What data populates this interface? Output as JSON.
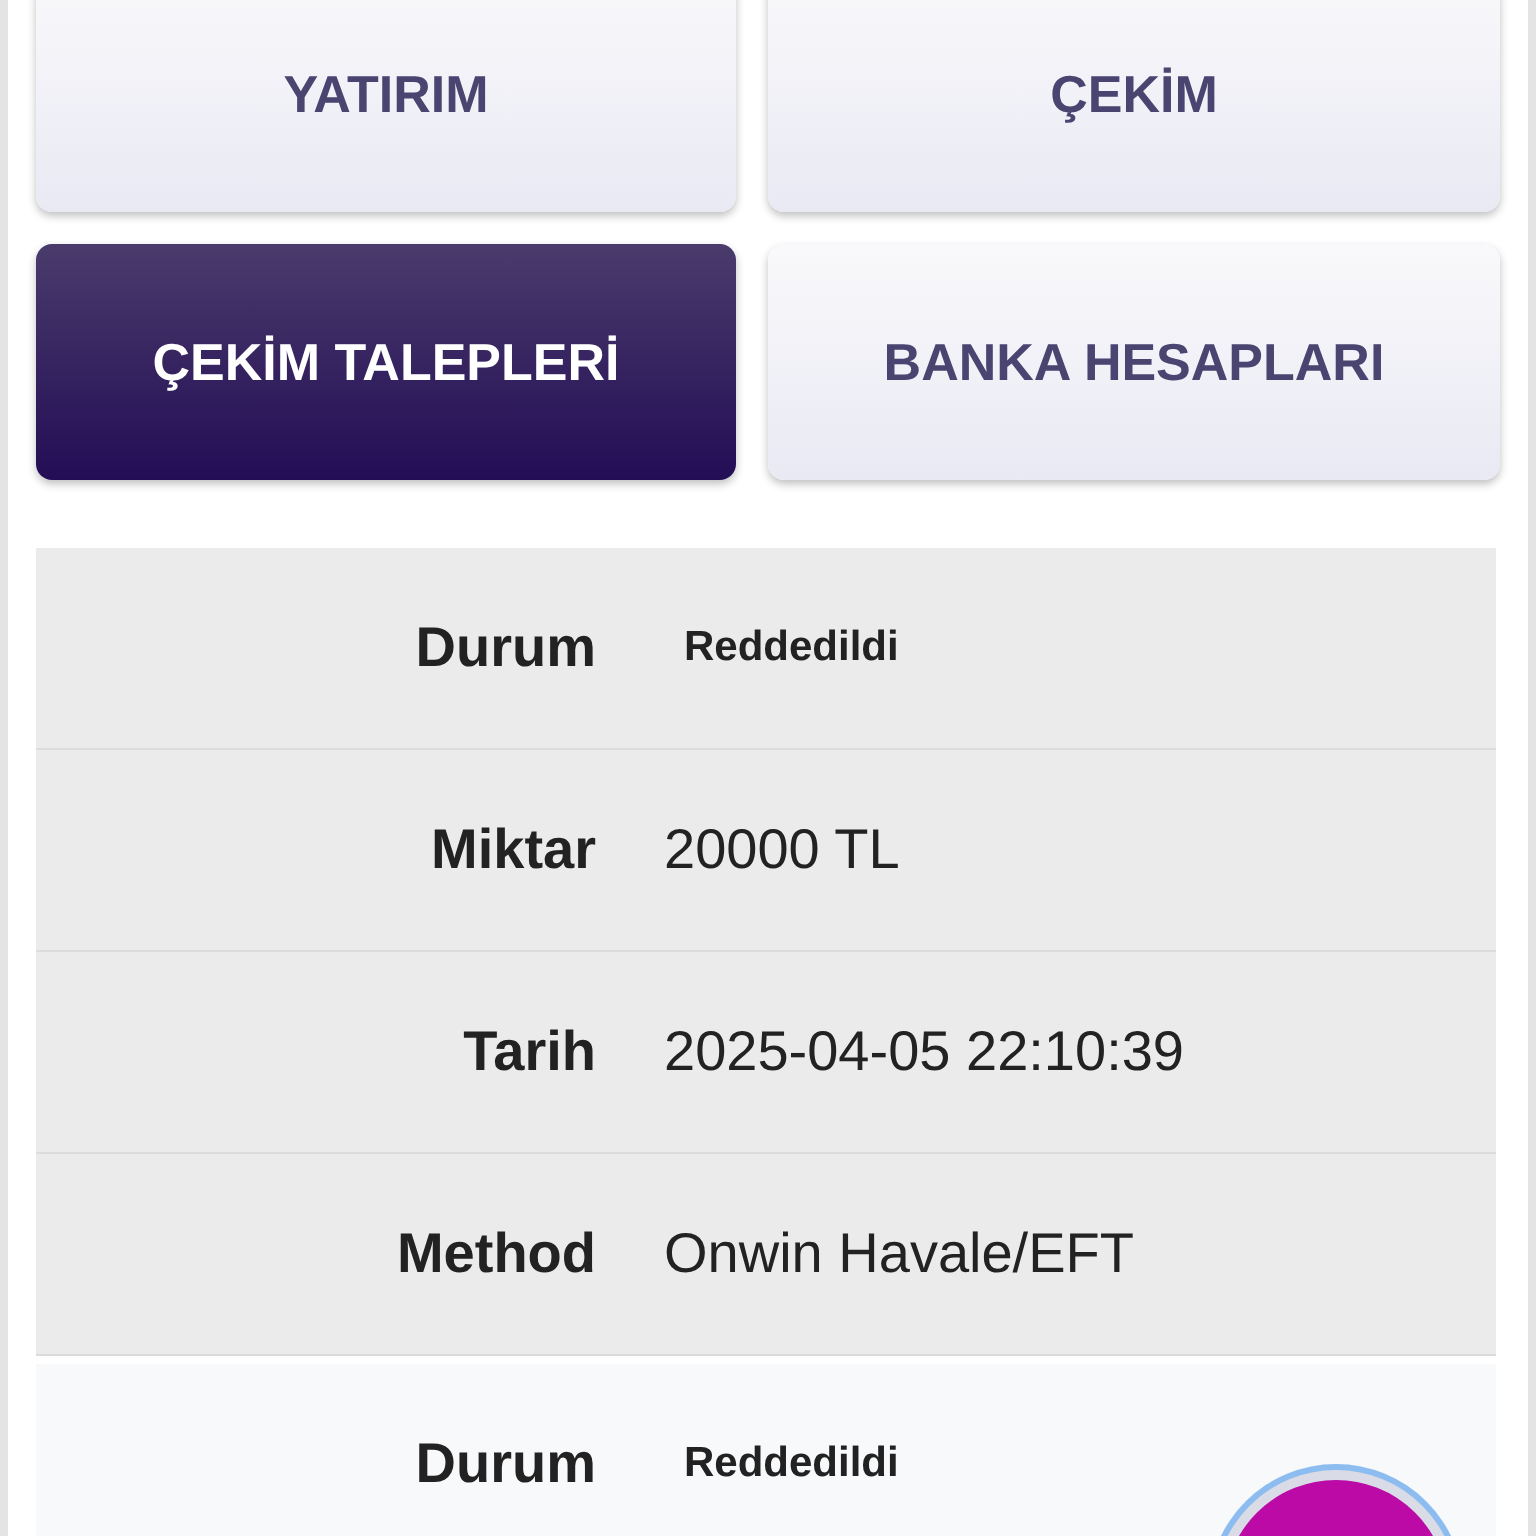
{
  "tabs": [
    {
      "label": "YATIRIM",
      "selected": false
    },
    {
      "label": "ÇEKİM",
      "selected": false
    },
    {
      "label": "ÇEKİM TALEPLERİ",
      "selected": true
    },
    {
      "label": "BANKA HESAPLARI",
      "selected": false
    }
  ],
  "requests": [
    {
      "rows": [
        {
          "kind": "status",
          "label": "Durum",
          "value": "Reddedildi"
        },
        {
          "kind": "text",
          "label": "Miktar",
          "value": "20000 TL"
        },
        {
          "kind": "text",
          "label": "Tarih",
          "value": "2025-04-05 22:10:39"
        },
        {
          "kind": "text",
          "label": "Method",
          "value": "Onwin Havale/EFT"
        }
      ]
    },
    {
      "rows": [
        {
          "kind": "status",
          "label": "Durum",
          "value": "Reddedildi"
        }
      ]
    }
  ]
}
